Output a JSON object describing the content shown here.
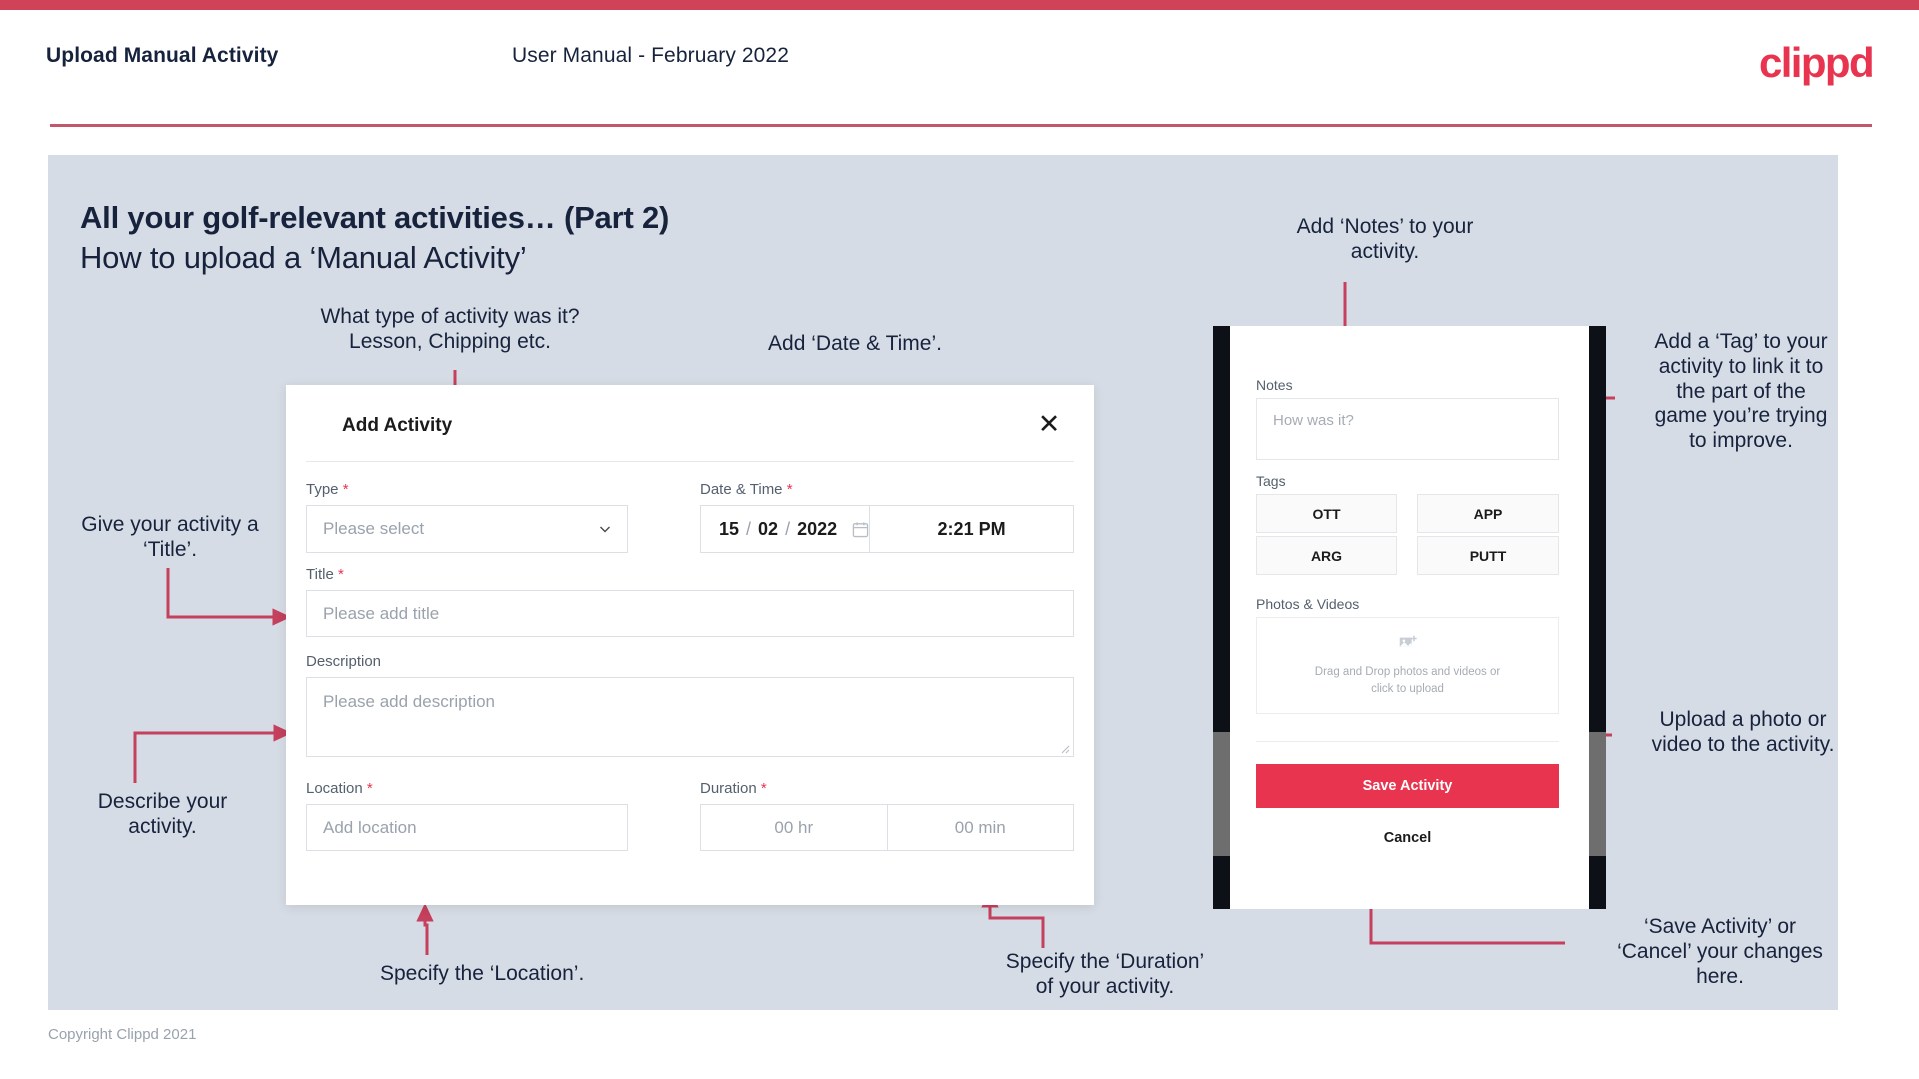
{
  "header": {
    "title": "Upload Manual Activity",
    "subtitle": "User Manual - February 2022",
    "brand": "clippd"
  },
  "slide": {
    "heading": "All your golf-relevant activities… (Part 2)",
    "subheading": "How to upload a ‘Manual Activity’"
  },
  "annotations": {
    "type": "What type of activity was it?\nLesson, Chipping etc.",
    "datetime": "Add ‘Date & Time’.",
    "title": "Give your activity a\n‘Title’.",
    "description": "Describe your\nactivity.",
    "location": "Specify the ‘Location’.",
    "duration": "Specify the ‘Duration’\nof your activity.",
    "notes": "Add ‘Notes’ to your\nactivity.",
    "tags": "Add a ‘Tag’ to your\nactivity to link it to\nthe part of the\ngame you’re trying\nto improve.",
    "photos": "Upload a photo or\nvideo to the activity.",
    "save": "‘Save Activity’ or\n‘Cancel’ your changes\nhere."
  },
  "dialog": {
    "title": "Add Activity",
    "close_label": "✕",
    "fields": {
      "type": {
        "label": "Type",
        "required": "*",
        "placeholder": "Please select"
      },
      "datetime": {
        "label": "Date & Time",
        "required": "*",
        "day": "15",
        "month": "02",
        "year": "2022",
        "sep": "/",
        "time": "2:21 PM"
      },
      "title": {
        "label": "Title",
        "required": "*",
        "placeholder": "Please add title"
      },
      "description": {
        "label": "Description",
        "required": "",
        "placeholder": "Please add description"
      },
      "location": {
        "label": "Location",
        "required": "*",
        "placeholder": "Add location"
      },
      "duration": {
        "label": "Duration",
        "required": "*",
        "hours": "00 hr",
        "minutes": "00 min"
      }
    }
  },
  "phone": {
    "notes": {
      "label": "Notes",
      "placeholder": "How was it?"
    },
    "tags": {
      "label": "Tags",
      "items": [
        "OTT",
        "APP",
        "ARG",
        "PUTT"
      ]
    },
    "photos": {
      "label": "Photos & Videos",
      "drop_line1": "Drag and Drop photos and videos or",
      "drop_line2": "click to upload"
    },
    "save_label": "Save Activity",
    "cancel_label": "Cancel"
  },
  "footer": {
    "copyright": "Copyright Clippd 2021"
  },
  "colors": {
    "accent": "#e8344f",
    "strip": "#cf4257",
    "panel": "#d6dce5",
    "ink": "#17233d"
  }
}
